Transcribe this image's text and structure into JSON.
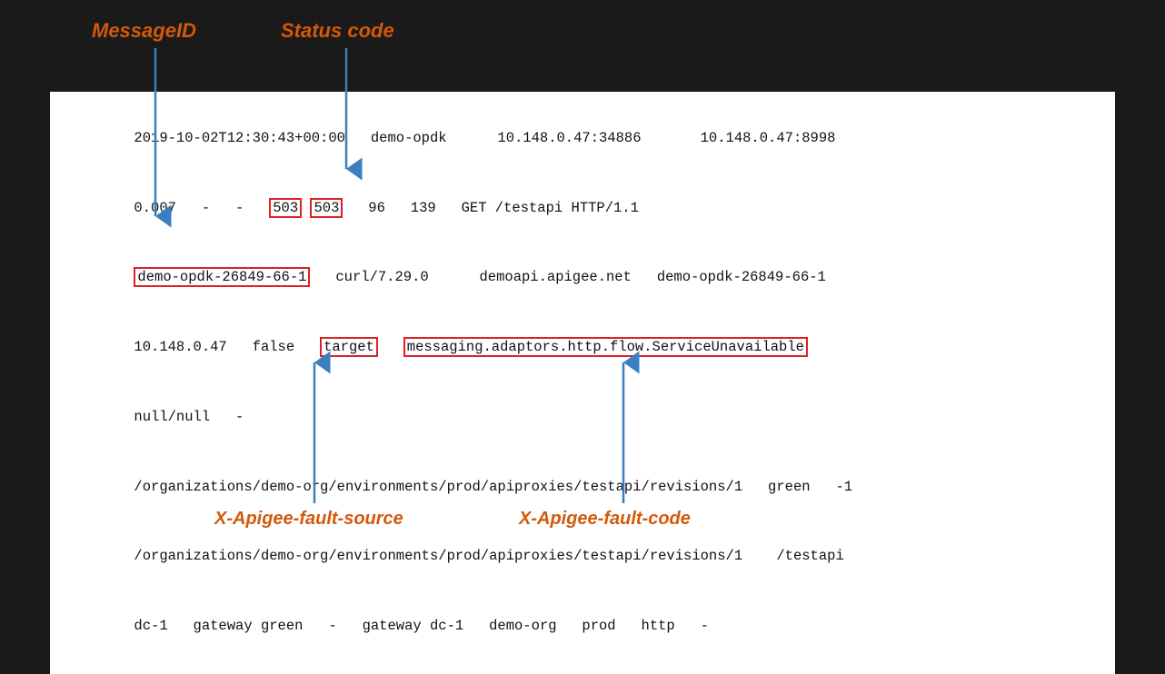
{
  "labels": {
    "messageid": "MessageID",
    "statuscode": "Status code",
    "faultsource": "X-Apigee-fault-source",
    "faultcode": "X-Apigee-fault-code"
  },
  "log": {
    "line1": "2019-10-02T12:30:43+00:00   demo-opdk      10.148.0.47:34886       10.148.0.47:8998",
    "line2_pre": "0.007   -   -   ",
    "line2_503a": "503",
    "line2_503b": "503",
    "line2_post": "   96   139   GET /testapi HTTP/1.1",
    "line3_pre": "",
    "line3_messageid": "demo-opdk-26849-66-1",
    "line3_post": "   curl/7.29.0      demoapi.apigee.net   demo-opdk-26849-66-1",
    "line4_pre": "10.148.0.47   false   ",
    "line4_target": "target",
    "line4_space": "   ",
    "line4_faultcode": "messaging.adaptors.http.flow.ServiceUnavailable",
    "line5": "null/null   -",
    "line6": "/organizations/demo-org/environments/prod/apiproxies/testapi/revisions/1   green   -1",
    "line7": "/organizations/demo-org/environments/prod/apiproxies/testapi/revisions/1    /testapi",
    "line8": "dc-1   gateway green   -   gateway dc-1   demo-org   prod   http   -"
  }
}
